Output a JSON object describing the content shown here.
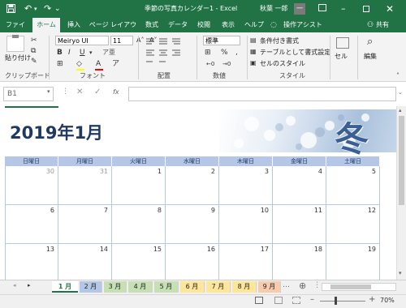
{
  "titlebar": {
    "title": "季節の写真カレンダー1  -  Excel",
    "user": "秋葉 一郎",
    "user_initial": "一",
    "save_icon": "save-icon",
    "undo_icon": "undo-icon",
    "redo_icon": "redo-icon"
  },
  "ribbon_tabs": [
    "ファイル",
    "ホーム",
    "挿入",
    "ページ レイアウト",
    "数式",
    "データ",
    "校閲",
    "表示",
    "ヘルプ",
    "操作アシスト"
  ],
  "share_label": "共有",
  "ribbon": {
    "paste": "貼り付け",
    "clipboard": "クリップボード",
    "font_name": "Meiryo UI",
    "font_size": "11",
    "bold": "B",
    "italic": "I",
    "underline": "U",
    "font_group": "フォント",
    "align_group": "配置",
    "number_format": "標準",
    "percent": "%",
    "comma": ",",
    "number_group": "数値",
    "cond_format": "条件付き書式",
    "table_format": "テーブルとして書式設定",
    "cell_style": "セルのスタイル",
    "style_group": "スタイル",
    "cells": "セル",
    "editing": "編集"
  },
  "formula_bar": {
    "name_box": "B1",
    "fx": "fx",
    "value": ""
  },
  "calendar": {
    "title": "2019年1月",
    "banner_kanji": "冬",
    "weekdays": [
      "日曜日",
      "月曜日",
      "火曜日",
      "水曜日",
      "木曜日",
      "金曜日",
      "土曜日"
    ],
    "weeks": [
      [
        "30",
        "31",
        "1",
        "2",
        "3",
        "4",
        "5"
      ],
      [
        "6",
        "7",
        "8",
        "9",
        "10",
        "11",
        "12"
      ],
      [
        "13",
        "14",
        "15",
        "16",
        "17",
        "18",
        "19"
      ]
    ]
  },
  "sheet_tabs": [
    "1 月",
    "2 月",
    "3 月",
    "4 月",
    "5 月",
    "6 月",
    "7 月",
    "8 月",
    "9 月"
  ],
  "sheet_tab_colors": [
    "#ffffff",
    "#b4c7e7",
    "#c6e0b4",
    "#c6e0b4",
    "#c6e0b4",
    "#ffe699",
    "#ffe699",
    "#ffe699",
    "#f8cbad"
  ],
  "status": {
    "zoom": "70%"
  }
}
